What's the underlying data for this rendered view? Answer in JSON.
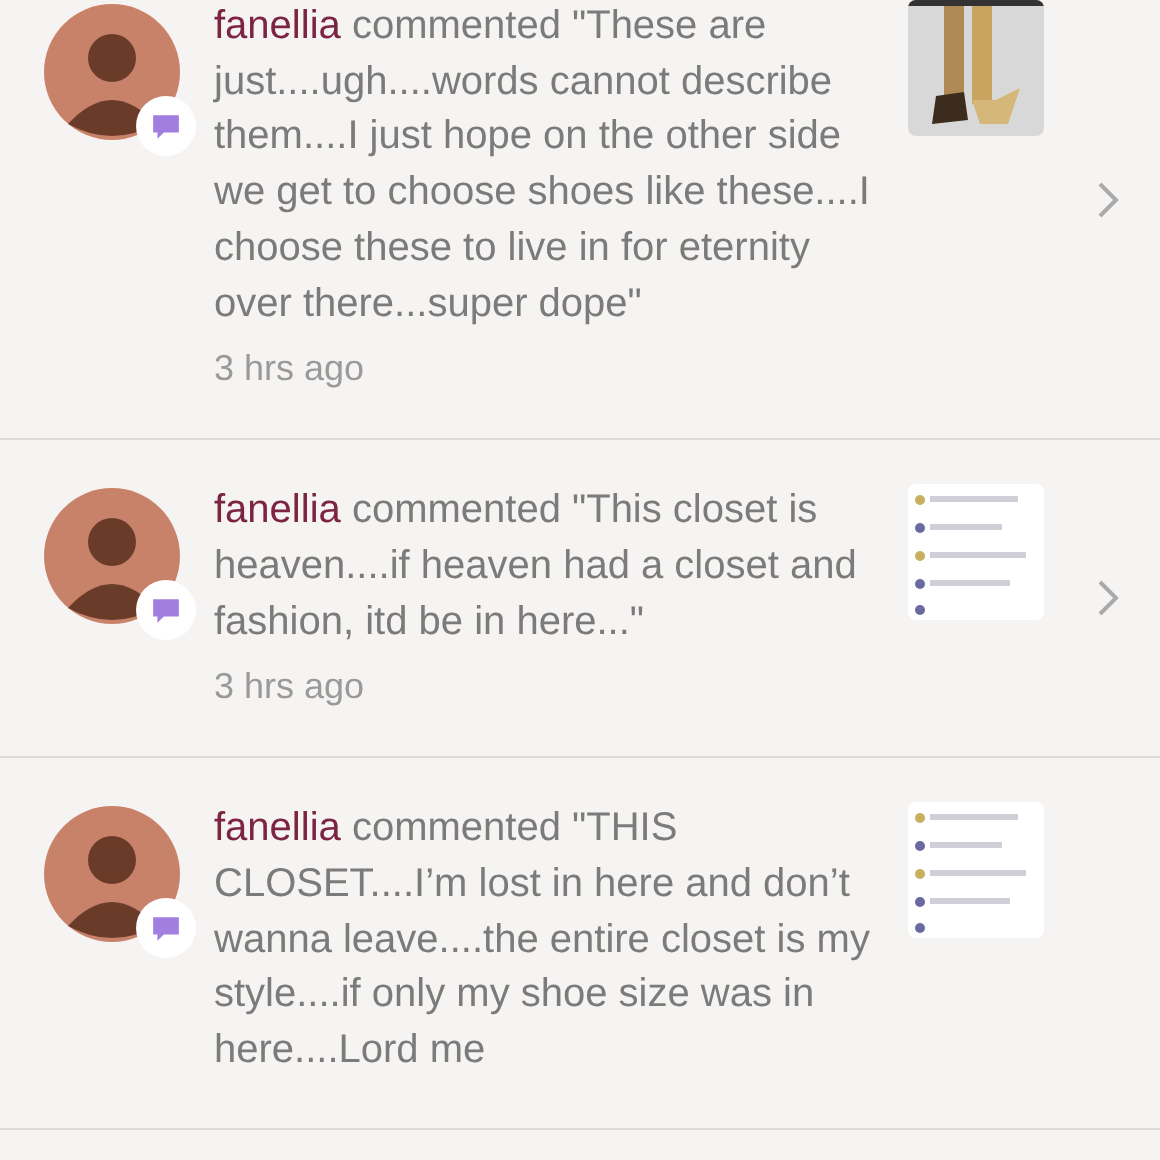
{
  "notifications": [
    {
      "user": "fanellia",
      "action": "commented",
      "comment": "\"These are just....ugh....words cannot describe them....I just hope on the other side we get to choose shoes like these....I choose these to live in for eternity over there...super dope\"",
      "time": "3 hrs ago"
    },
    {
      "user": "fanellia",
      "action": "commented",
      "comment": "\"This closet is heaven....if heaven had a closet and fashion, itd be in here...\"",
      "time": "3 hrs ago"
    },
    {
      "user": "fanellia",
      "action": "commented",
      "comment": "\"THIS CLOSET....I’m lost in here and don’t wanna leave....the entire closet is my style....if only my shoe size was in here....Lord me"
    }
  ]
}
